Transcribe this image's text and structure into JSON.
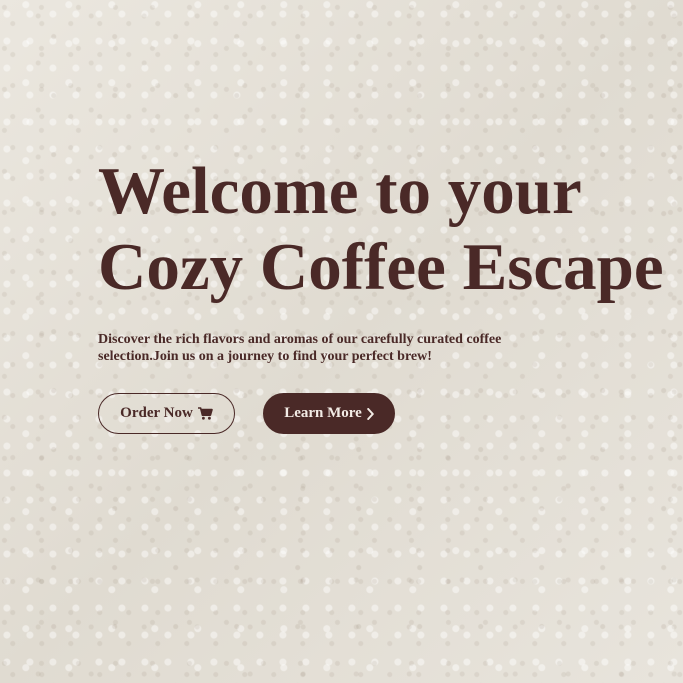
{
  "hero": {
    "headline_line1": "Welcome to your",
    "headline_line2": "Cozy Coffee Escape",
    "description": "Discover the rich flavors and aromas of our carefully curated coffee selection.Join us on a journey to find your perfect brew!",
    "order_button_label": "Order Now",
    "order_button_icon": "shopping-cart-icon",
    "learn_button_label": "Learn More",
    "learn_button_icon": "chevron-right-icon"
  },
  "colors": {
    "brand": "#4a2927",
    "button_text_light": "#f3ece6",
    "background": "#e6e2da"
  }
}
